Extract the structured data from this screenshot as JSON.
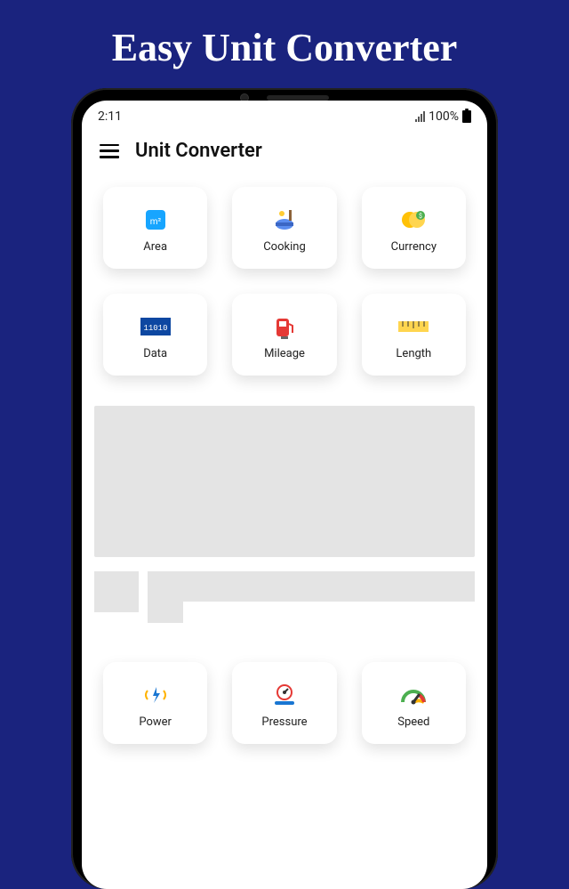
{
  "promo": {
    "title": "Easy Unit Converter"
  },
  "status": {
    "time": "2:11",
    "battery": "100%"
  },
  "header": {
    "title": "Unit Converter"
  },
  "cards": [
    {
      "label": "Area"
    },
    {
      "label": "Cooking"
    },
    {
      "label": "Currency"
    },
    {
      "label": "Data"
    },
    {
      "label": "Mileage"
    },
    {
      "label": "Length"
    },
    {
      "label": "Power"
    },
    {
      "label": "Pressure"
    },
    {
      "label": "Speed"
    }
  ]
}
